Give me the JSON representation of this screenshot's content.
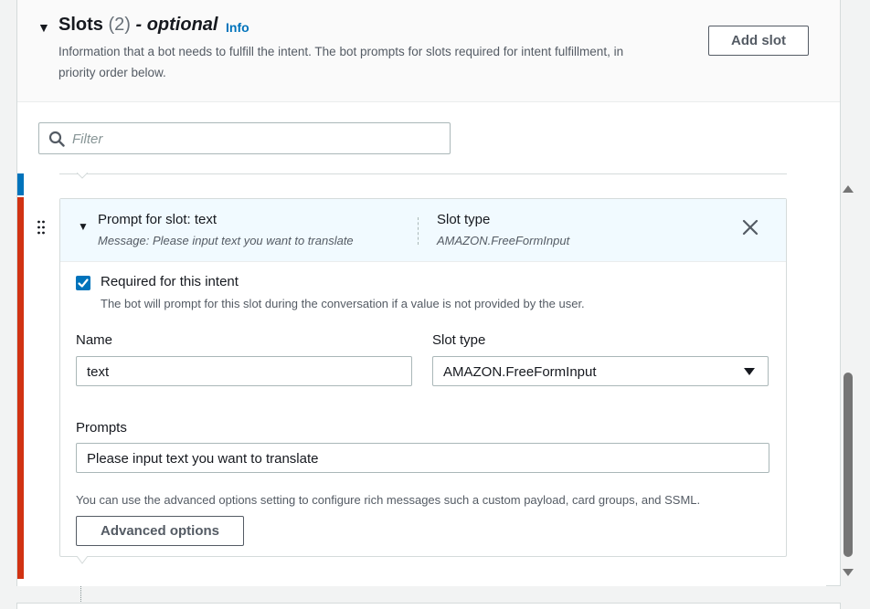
{
  "section": {
    "title": "Slots",
    "count": "(2)",
    "optional": "- optional",
    "info_link": "Info",
    "description": "Information that a bot needs to fulfill the intent. The bot prompts for slots required for intent fulfillment, in priority order below.",
    "add_slot_label": "Add slot"
  },
  "filter": {
    "placeholder": "Filter",
    "value": ""
  },
  "slot_card": {
    "header_title": "Prompt for slot: text",
    "header_message": "Message: Please input text you want to translate",
    "header_slot_type_label": "Slot type",
    "header_slot_type_value": "AMAZON.FreeFormInput",
    "required_checked": true,
    "required_label": "Required for this intent",
    "required_description": "The bot will prompt for this slot during the conversation if a value is not provided by the user.",
    "name_label": "Name",
    "name_value": "text",
    "slot_type_label": "Slot type",
    "slot_type_value": "AMAZON.FreeFormInput",
    "prompts_label": "Prompts",
    "prompts_value": "Please input text you want to translate",
    "advanced_description": "You can use the advanced options setting to configure rich messages such a custom payload, card groups, and SSML.",
    "advanced_button_label": "Advanced options"
  },
  "icons": {
    "collapse": "caret-down-icon",
    "search": "search-icon",
    "drag": "drag-handle-icon",
    "close": "close-icon",
    "check": "checkmark-icon",
    "select": "select-caret-icon"
  },
  "colors": {
    "accent": "#0073bb",
    "error_bar": "#d13212",
    "card_header_bg": "#f1faff"
  }
}
